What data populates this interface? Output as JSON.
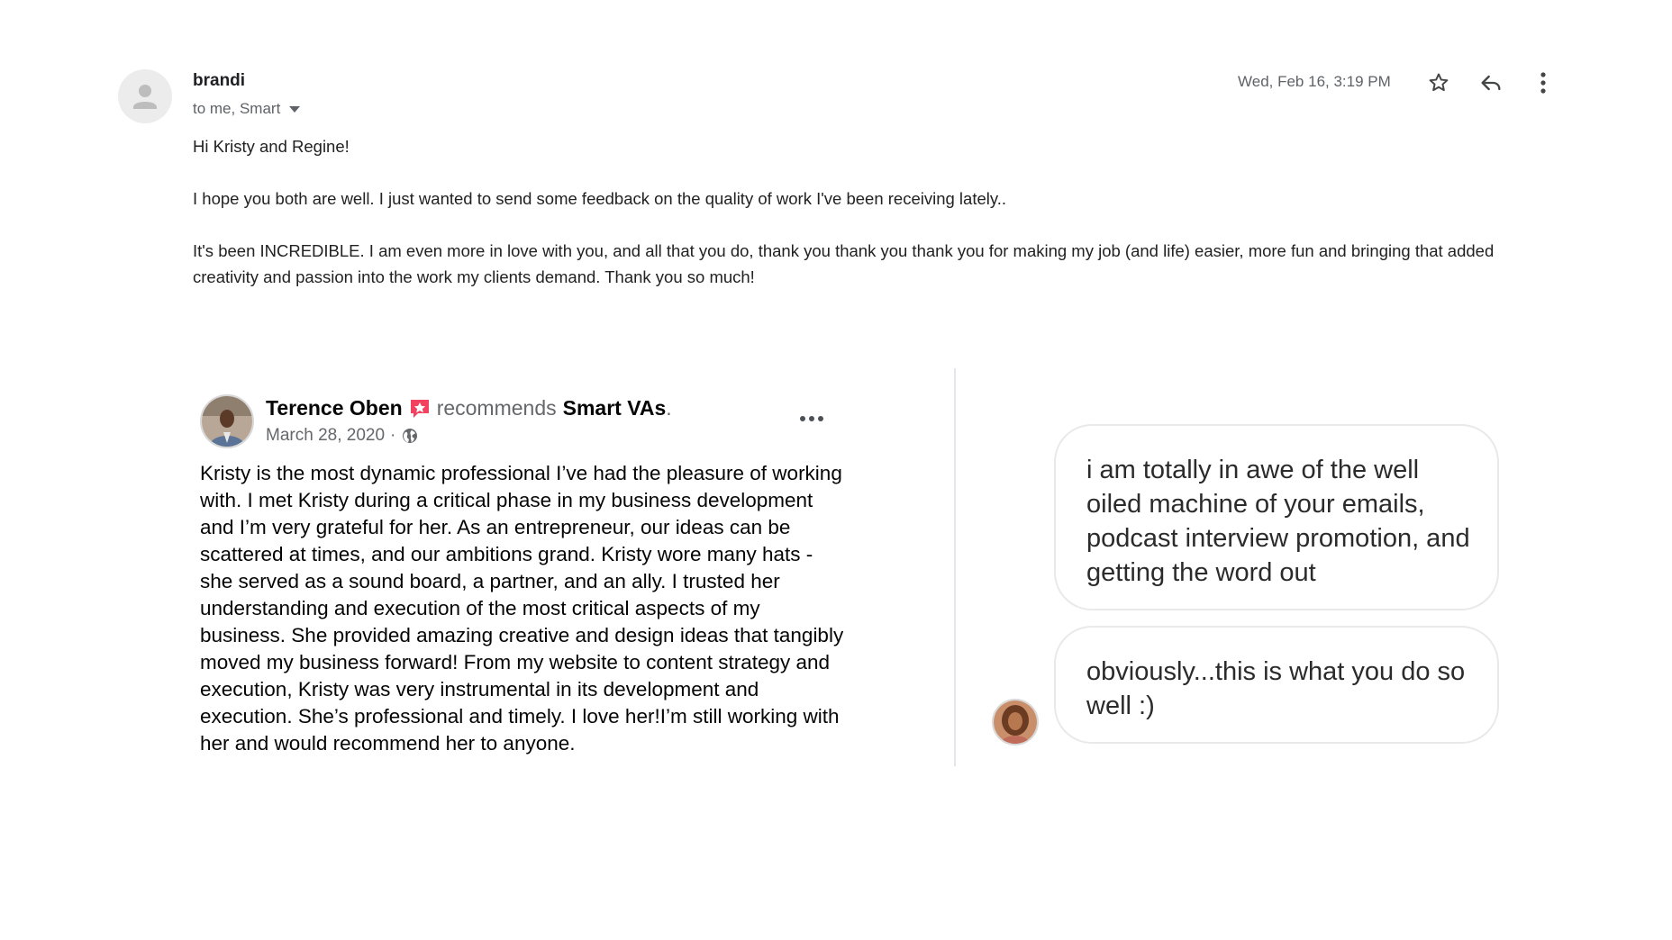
{
  "email": {
    "sender": "brandi",
    "recipients": "to me, Smart",
    "date": "Wed, Feb 16, 3:19 PM",
    "body": [
      "Hi Kristy and Regine!",
      "I hope you both are well. I just wanted to send some feedback on the quality of work I've been receiving lately..",
      "It's been INCREDIBLE. I am even more in love with you, and all that you do, thank you thank you thank you for making my job (and life) easier, more fun and bringing that added creativity and passion into the work my clients demand. Thank you so much!"
    ],
    "icons": {
      "avatar": "person-icon",
      "details": "chevron-down-icon",
      "star": "star-icon",
      "reply": "reply-icon",
      "more": "more-vert-icon"
    }
  },
  "recommendation": {
    "author": "Terence Oben",
    "verb": "recommends",
    "page": "Smart VAs",
    "punctuation": ".",
    "date": "March 28, 2020",
    "separator": "·",
    "text": "Kristy is the most dynamic professional I’ve had the pleasure of working with. I met Kristy during a critical phase in my business development and I’m very grateful for her. As an entrepreneur, our ideas can be scattered at times, and our ambitions grand. Kristy wore many hats - she served as a sound board, a partner, and an ally. I trusted her understanding and execution of the most critical aspects of my business. She provided amazing creative and design ideas that tangibly moved my business forward! From my website to content strategy and execution, Kristy was very instrumental in its development and execution. She’s professional and timely. I love her!I’m still working with her and would recommend her to anyone.",
    "icons": {
      "badge": "recommendation-star-icon",
      "audience": "globe-icon",
      "options": "more-horizontal-icon"
    },
    "colors": {
      "badge": "#f3425f"
    }
  },
  "chat": {
    "messages": [
      "i am totally in awe of the well oiled machine of your emails, podcast interview promotion, and getting the word out",
      "obviously...this is what you do so well :)"
    ]
  }
}
